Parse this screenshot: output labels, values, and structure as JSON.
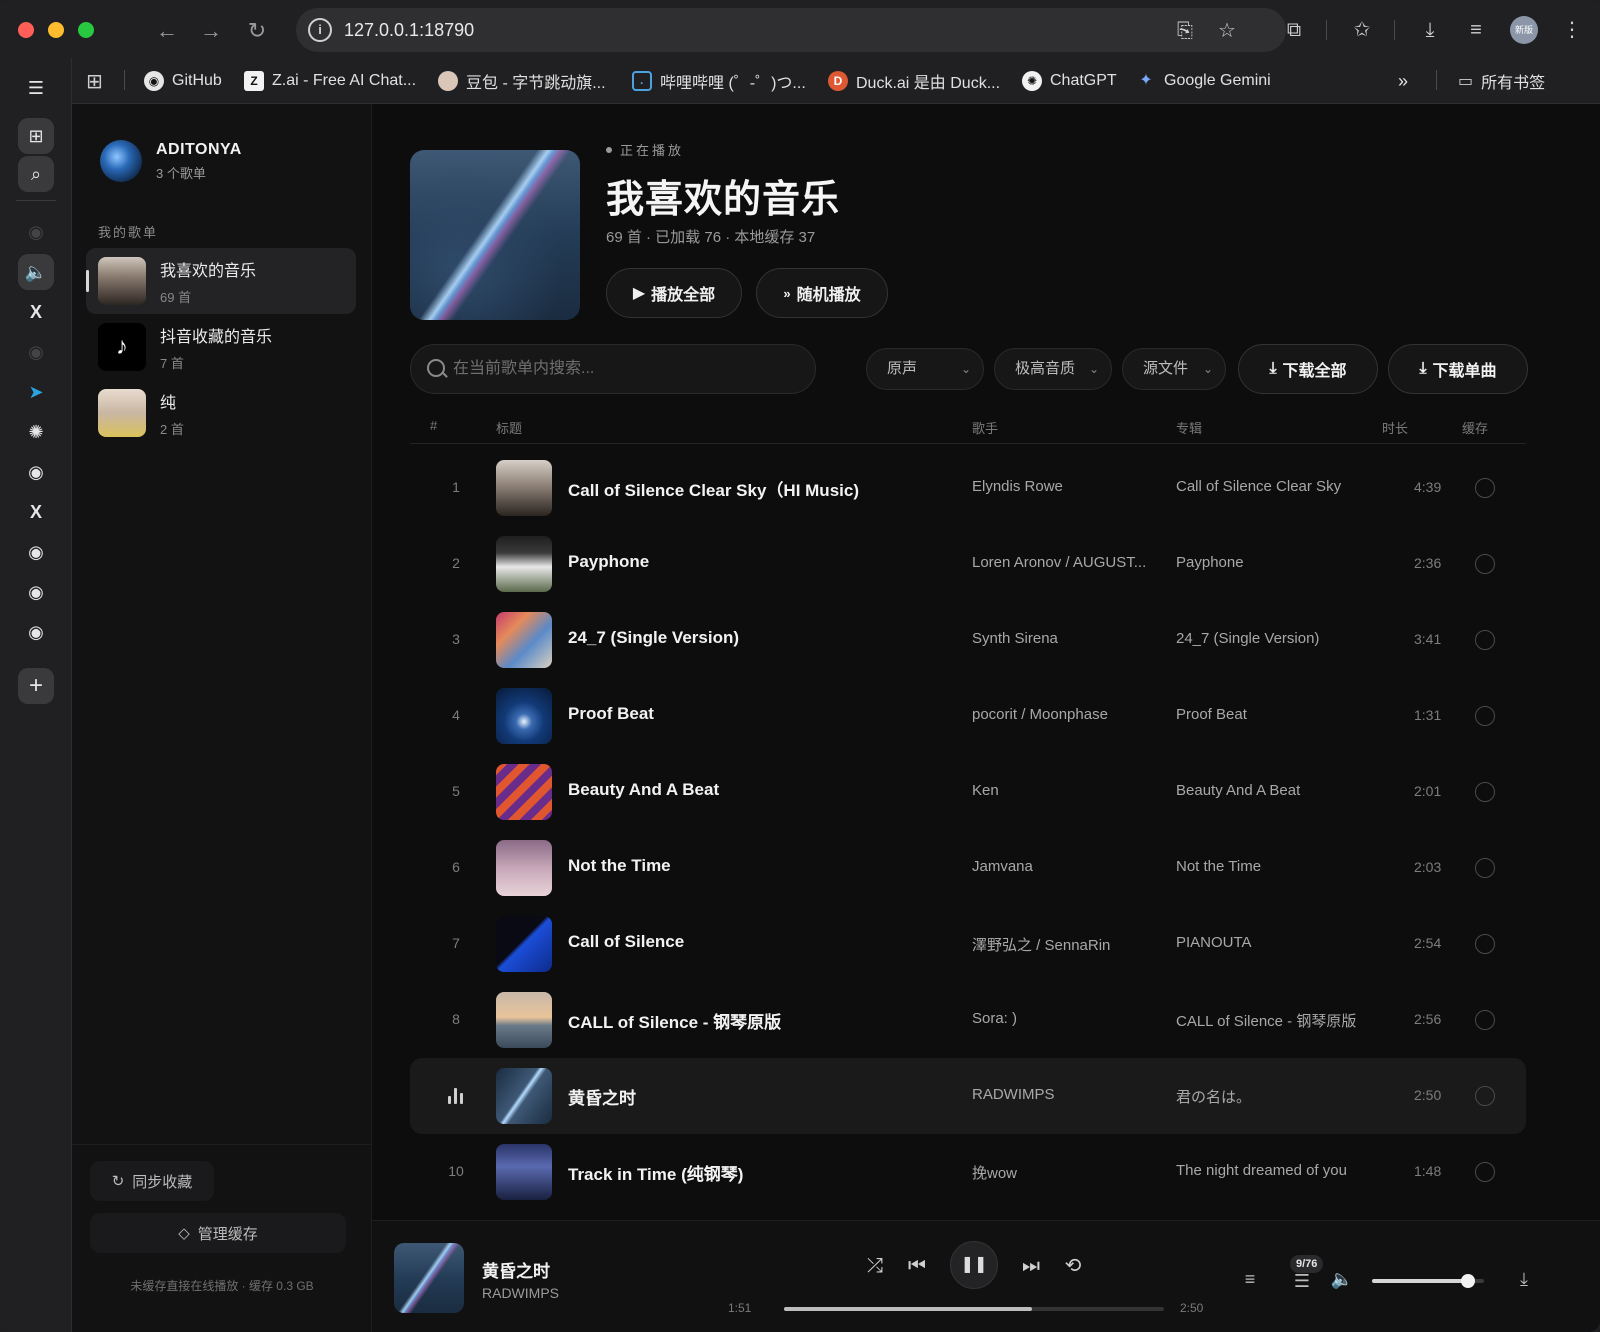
{
  "browser": {
    "url": "127.0.0.1:18790",
    "profile_label": "新版",
    "bookmarks": [
      {
        "label": "GitHub",
        "icon": "github-icon"
      },
      {
        "label": "Z.ai - Free AI Chat...",
        "icon": "zai-icon"
      },
      {
        "label": "豆包 - 字节跳动旗...",
        "icon": "doubao-icon"
      },
      {
        "label": "哔哩哔哩 (゜-゜)つ...",
        "icon": "bilibili-icon"
      },
      {
        "label": "Duck.ai 是由 Duck...",
        "icon": "duckduckgo-icon"
      },
      {
        "label": "ChatGPT",
        "icon": "chatgpt-icon"
      },
      {
        "label": "Google Gemini",
        "icon": "gemini-icon"
      }
    ],
    "all_bookmarks_label": "所有书签",
    "overflow_icon": "»"
  },
  "library": {
    "user_name": "ADITONYA",
    "user_sub": "3 个歌单",
    "section_label": "我的歌单",
    "playlists": [
      {
        "name": "我喜欢的音乐",
        "count": "69 首"
      },
      {
        "name": "抖音收藏的音乐",
        "count": "7 首"
      },
      {
        "name": "纯",
        "count": "2 首"
      }
    ],
    "sync_label": "同步收藏",
    "cache_label": "管理缓存",
    "footer_note": "未缓存直接在线播放 · 缓存 0.3 GB"
  },
  "hero": {
    "now_tag": "正在播放",
    "title": "我喜欢的音乐",
    "meta": "69 首 · 已加载 76 · 本地缓存 37",
    "play_all": "播放全部",
    "shuffle": "随机播放"
  },
  "toolbar": {
    "search_placeholder": "在当前歌单内搜索...",
    "select_voice": "原声",
    "select_quality": "极高音质",
    "select_source": "源文件",
    "download_all": "下载全部",
    "download_single": "下载单曲"
  },
  "table": {
    "headers": {
      "index": "#",
      "title": "标题",
      "artist": "歌手",
      "album": "专辑",
      "duration": "时长",
      "cache": "缓存"
    },
    "rows": [
      {
        "index": "1",
        "title": "Call of Silence Clear Sky（HI Music)",
        "artist": "Elyndis Rowe",
        "album": "Call of Silence Clear Sky",
        "duration": "4:39"
      },
      {
        "index": "2",
        "title": "Payphone",
        "artist": "Loren Aronov / AUGUST...",
        "album": "Payphone",
        "duration": "2:36"
      },
      {
        "index": "3",
        "title": "24_7 (Single Version)",
        "artist": "Synth Sirena",
        "album": "24_7 (Single Version)",
        "duration": "3:41"
      },
      {
        "index": "4",
        "title": "Proof Beat",
        "artist": "pocorit / Moonphase",
        "album": "Proof Beat",
        "duration": "1:31"
      },
      {
        "index": "5",
        "title": "Beauty And A Beat",
        "artist": "Ken",
        "album": "Beauty And A Beat",
        "duration": "2:01"
      },
      {
        "index": "6",
        "title": "Not the Time",
        "artist": "Jamvana",
        "album": "Not the Time",
        "duration": "2:03"
      },
      {
        "index": "7",
        "title": "Call of Silence",
        "artist": "澤野弘之 / SennaRin",
        "album": "PIANOUTA",
        "duration": "2:54"
      },
      {
        "index": "8",
        "title": "CALL of Silence - 钢琴原版",
        "artist": "Sora: )",
        "album": "CALL of Silence - 钢琴原版",
        "duration": "2:56"
      },
      {
        "index": "",
        "title": "黄昏之时",
        "artist": "RADWIMPS",
        "album": "君の名は。",
        "duration": "2:50",
        "playing": true
      },
      {
        "index": "10",
        "title": "Track in Time (纯钢琴)",
        "artist": "挽wow",
        "album": "The night dreamed of you",
        "duration": "1:48"
      }
    ]
  },
  "player": {
    "title": "黄昏之时",
    "artist": "RADWIMPS",
    "elapsed": "1:51",
    "total": "2:50",
    "progress_fraction": 0.653,
    "queue_badge": "9/76",
    "volume_fraction": 0.86
  },
  "colors": {
    "accent": "#f2f2f2",
    "background": "#0d0d0d"
  }
}
